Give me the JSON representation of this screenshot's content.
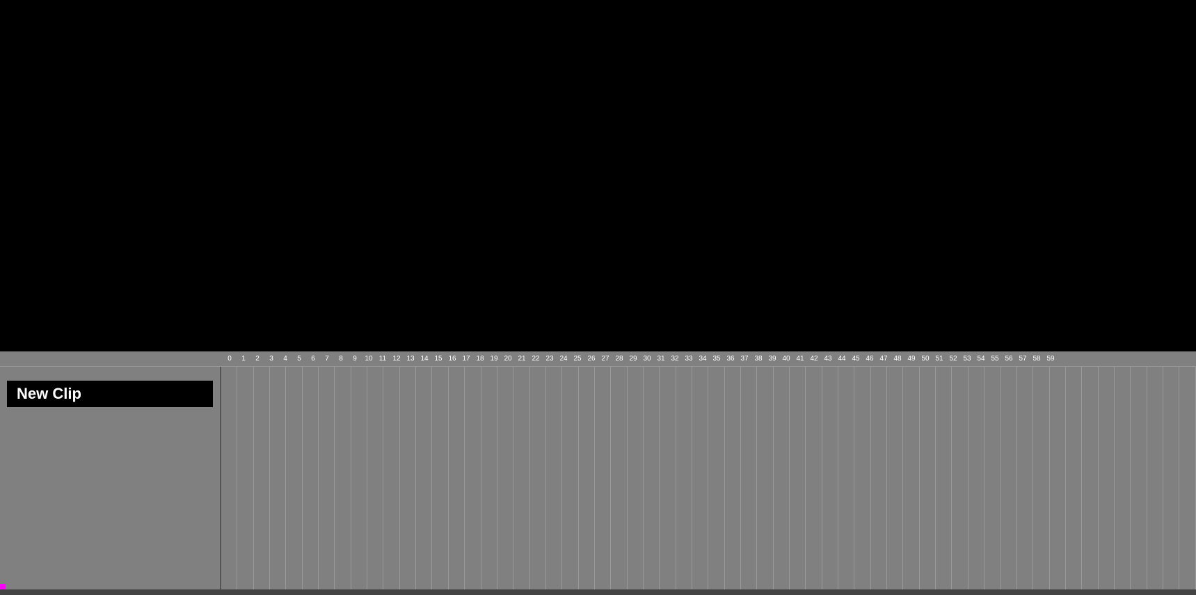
{
  "video_area": {
    "background": "#000000"
  },
  "timeline": {
    "new_clip_label": "New Clip",
    "ruler_numbers": [
      "0",
      "1",
      "2",
      "3",
      "4",
      "5",
      "6",
      "7",
      "8",
      "9",
      "10",
      "11",
      "12",
      "13",
      "14",
      "15",
      "16",
      "17",
      "18",
      "19",
      "20",
      "21",
      "22",
      "23",
      "24",
      "25",
      "26",
      "27",
      "28",
      "29",
      "30",
      "31",
      "32",
      "33",
      "34",
      "35",
      "36",
      "37",
      "38",
      "39",
      "40",
      "41",
      "42",
      "43",
      "44",
      "45",
      "46",
      "47",
      "48",
      "49",
      "50",
      "51",
      "52",
      "53",
      "54",
      "55",
      "56",
      "57",
      "58",
      "59"
    ],
    "grid_columns": 60,
    "colors": {
      "background": "#808080",
      "grid_line": "#999999",
      "text": "#ffffff",
      "label_bg": "#000000",
      "indicator": "#ff00ff"
    }
  }
}
